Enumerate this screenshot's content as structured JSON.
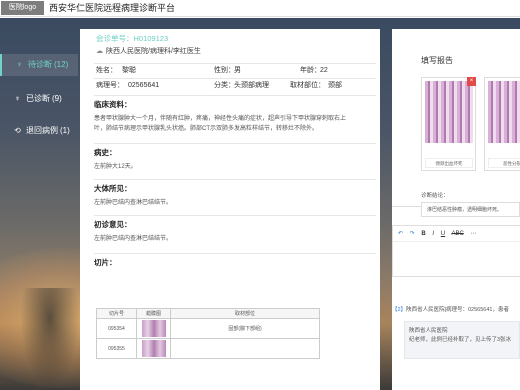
{
  "header": {
    "logo_text": "医院logo",
    "title": "西安华仁医院远程病理诊断平台"
  },
  "sidebar": {
    "items": [
      {
        "label": "待诊断",
        "count": "(12)",
        "icon": "stethoscope-icon"
      },
      {
        "label": "已诊断",
        "count": "(9)",
        "icon": "stethoscope-icon"
      },
      {
        "label": "退回病例",
        "count": "(1)",
        "icon": "return-icon"
      }
    ]
  },
  "case": {
    "case_no": "会诊单号：H0109123",
    "hospital": "陕西人民医院/病理科/李红医生",
    "name_label": "姓名：",
    "name": "黎聪",
    "sex_label": "性别：",
    "sex": "男",
    "age_label": "年龄：",
    "age": "22",
    "path_no_label": "病理号：",
    "path_no": "02565641",
    "category_label": "分类：",
    "category": "头颈部病理",
    "site_label": "取材部位：",
    "site": "颈部"
  },
  "sections": {
    "clinical_title": "临床资料：",
    "clinical_body": "患者甲状腺肿大一个月，伴随有红肿，疼痛，神经性头痛的症状，超声引导下甲状腺穿刺取右上叶，肺结节病理示甲状腺乳头状癌。肺部CT示双肺多发高粒样结节，转移灶不除外。",
    "history_title": "病史：",
    "history_body": "左前肿大12天。",
    "gross_title": "大体所见：",
    "gross_body": "左前肿巴结内查淋巴结结节。",
    "initial_title": "初诊意见：",
    "initial_body": "左前肿巴结内查淋巴结结节。",
    "slices_title": "切片："
  },
  "slice_table": {
    "headers": [
      "切片号",
      "蜡膜图",
      "取材部位"
    ],
    "rows": [
      {
        "no": "095354",
        "site": "固部(腺下部组)"
      },
      {
        "no": "095355",
        "site": ""
      }
    ]
  },
  "report": {
    "title": "填写报告",
    "images": [
      {
        "caption": "颈颏出血坏死"
      },
      {
        "caption": "恶性分裂"
      }
    ],
    "diag_label": "诊断结论：",
    "diag_text": "淋巴结恶性肿瘤，透明细胞坏死。"
  },
  "editor": {
    "undo": "↶",
    "redo": "↷",
    "bold": "B",
    "italic": "I",
    "underline": "U",
    "strike": "ABC",
    "more": "⋯"
  },
  "messages": {
    "head_tag": "【2】",
    "head_text": "陕西省人民医院|病理号：02565641，患者",
    "sender": "陕西省人民医院",
    "body": "纪老师，此例已经补取了，见上传了3张冰"
  }
}
